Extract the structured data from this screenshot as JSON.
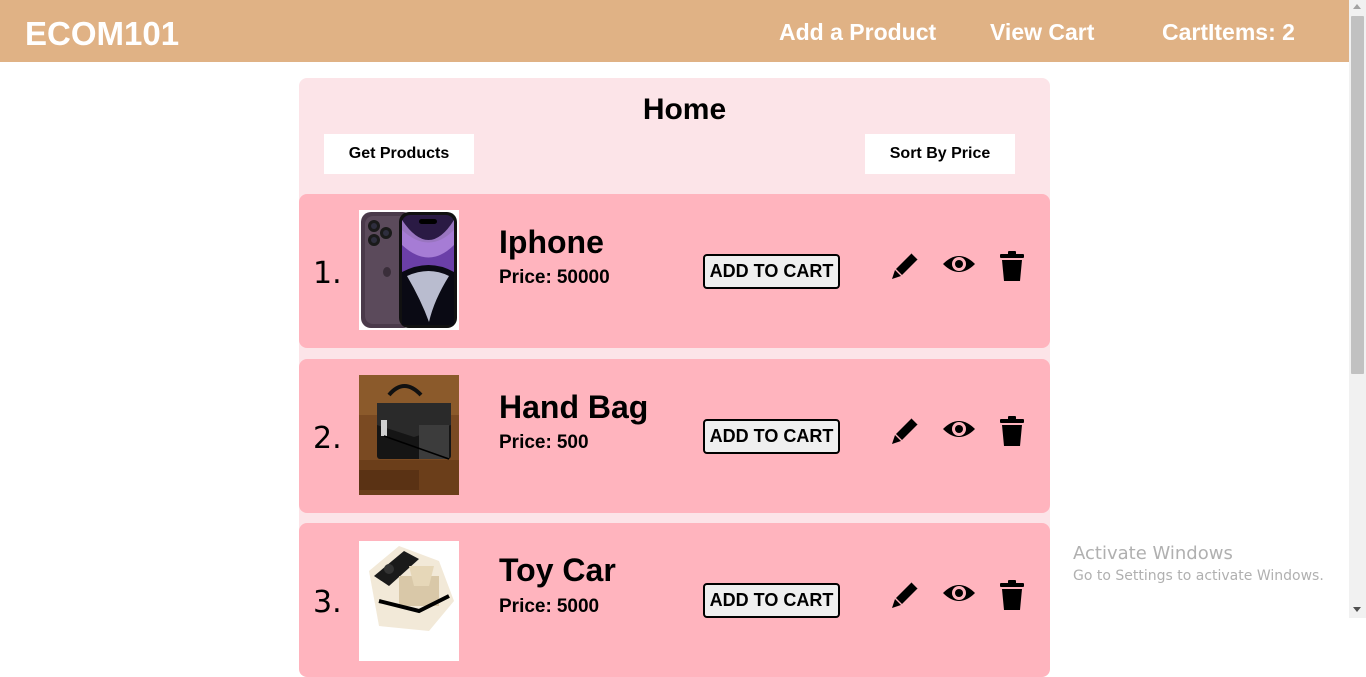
{
  "navbar": {
    "brand": "ECOM101",
    "links": {
      "add_product": "Add a Product",
      "view_cart": "View Cart",
      "cart_items": "CartItems: 2"
    }
  },
  "home": {
    "title": "Home",
    "get_products_label": "Get Products",
    "sort_label": "Sort By Price"
  },
  "products": [
    {
      "index": "1.",
      "name": "Iphone",
      "price_label": "Price:",
      "price": "50000",
      "add_to_cart": "ADD TO CART"
    },
    {
      "index": "2.",
      "name": "Hand Bag",
      "price_label": "Price:",
      "price": "500",
      "add_to_cart": "ADD TO CART"
    },
    {
      "index": "3.",
      "name": "Toy Car",
      "price_label": "Price:",
      "price": "5000",
      "add_to_cart": "ADD TO CART"
    }
  ],
  "icons": [
    "pencil-icon",
    "eye-icon",
    "trash-icon"
  ],
  "watermark": {
    "title": "Activate Windows",
    "subtitle": "Go to Settings to activate Windows."
  },
  "colors": {
    "navbar": "#e0b285",
    "panel": "#fce4e8",
    "card": "#ffb4be"
  }
}
